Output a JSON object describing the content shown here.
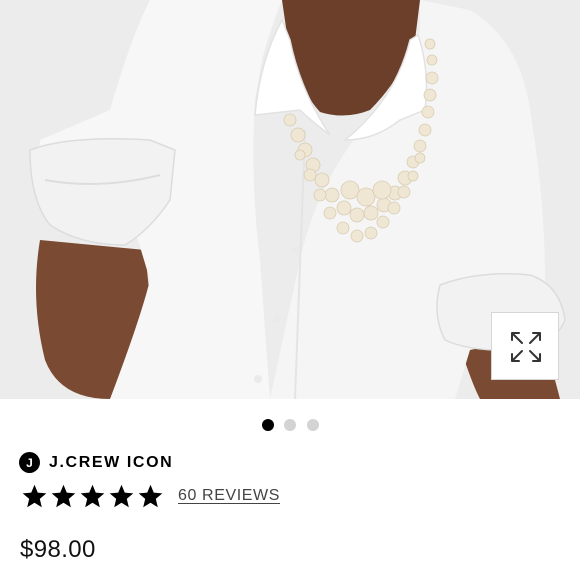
{
  "product_image": {
    "icon": "expand-arrows-icon"
  },
  "carousel": {
    "count": 3,
    "active_index": 0
  },
  "brand": {
    "badge_letter": "J",
    "name": "J.CREW ICON"
  },
  "rating": {
    "stars": 5,
    "max_stars": 5,
    "reviews_label": "60 REVIEWS"
  },
  "price": "$98.00",
  "colors": {
    "image_background": "#ececec",
    "star": "#000000",
    "dot_active": "#000000",
    "dot_inactive": "#d3d3d3"
  }
}
